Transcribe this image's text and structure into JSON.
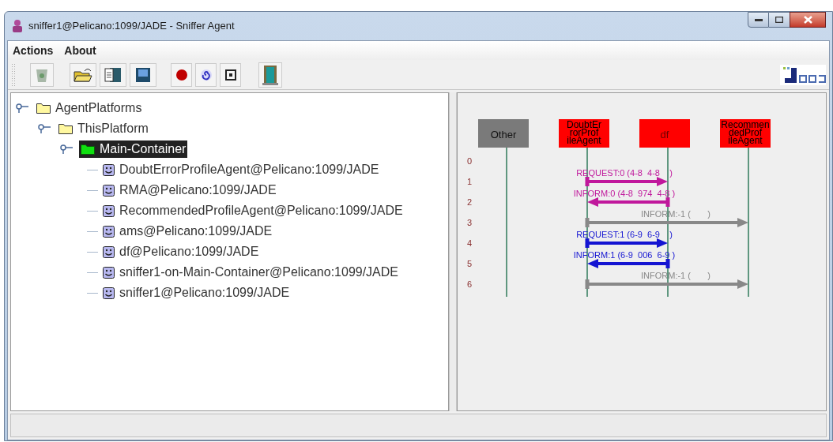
{
  "window": {
    "title": "sniffer1@Pelicano:1099/JADE - Sniffer Agent"
  },
  "menu": [
    "Actions",
    "About"
  ],
  "tree": [
    {
      "label": "AgentPlatforms",
      "kind": "folder",
      "expanded": true,
      "selected": false,
      "children": [
        {
          "label": "ThisPlatform",
          "kind": "folder",
          "expanded": true,
          "selected": false,
          "children": [
            {
              "label": "Main-Container",
              "kind": "container",
              "expanded": true,
              "selected": true,
              "children": [
                {
                  "label": "DoubtErrorProfileAgent@Pelicano:1099/JADE",
                  "kind": "agent",
                  "selected": false
                },
                {
                  "label": "RMA@Pelicano:1099/JADE",
                  "kind": "agent",
                  "selected": false
                },
                {
                  "label": "RecommendedProfileAgent@Pelicano:1099/JADE",
                  "kind": "agent",
                  "selected": false
                },
                {
                  "label": "ams@Pelicano:1099/JADE",
                  "kind": "agent",
                  "selected": false
                },
                {
                  "label": "df@Pelicano:1099/JADE",
                  "kind": "agent",
                  "selected": false
                },
                {
                  "label": "sniffer1-on-Main-Container@Pelicano:1099/JADE",
                  "kind": "agent",
                  "selected": false
                },
                {
                  "label": "sniffer1@Pelicano:1099/JADE",
                  "kind": "agent",
                  "selected": false
                }
              ]
            }
          ]
        }
      ]
    }
  ],
  "diagram": {
    "agents": [
      {
        "label_lines": [
          "Other"
        ],
        "color": "#7a7a7a"
      },
      {
        "label_lines": [
          "DoubtEr",
          "rorProf",
          "ileAgent"
        ],
        "color": "#ff0000"
      },
      {
        "label_lines": [
          "df"
        ],
        "color": "#ff0000"
      },
      {
        "label_lines": [
          "Recommen",
          "dedProf",
          "ileAgent"
        ],
        "color": "#ff0000"
      }
    ],
    "row_numbers": [
      "0",
      "1",
      "2",
      "3",
      "4",
      "5",
      "6"
    ],
    "messages": [
      {
        "label": "REQUEST:0 (4-8  4-8    )",
        "kind": "request",
        "color": "#c0189c"
      },
      {
        "label": "INFORM:0 (4-8  974  4-8 )",
        "kind": "reply",
        "color": "#c0189c"
      },
      {
        "label": "INFORM:-1 (       )",
        "kind": "broadcast",
        "color": "#888888"
      },
      {
        "label": "REQUEST:1 (6-9  6-9    )",
        "kind": "request",
        "color": "#1414d2"
      },
      {
        "label": "INFORM:1 (6-9  006  6-9 )",
        "kind": "reply",
        "color": "#1414d2"
      },
      {
        "label": "INFORM:-1 (       )",
        "kind": "broadcast",
        "color": "#888888"
      }
    ]
  }
}
